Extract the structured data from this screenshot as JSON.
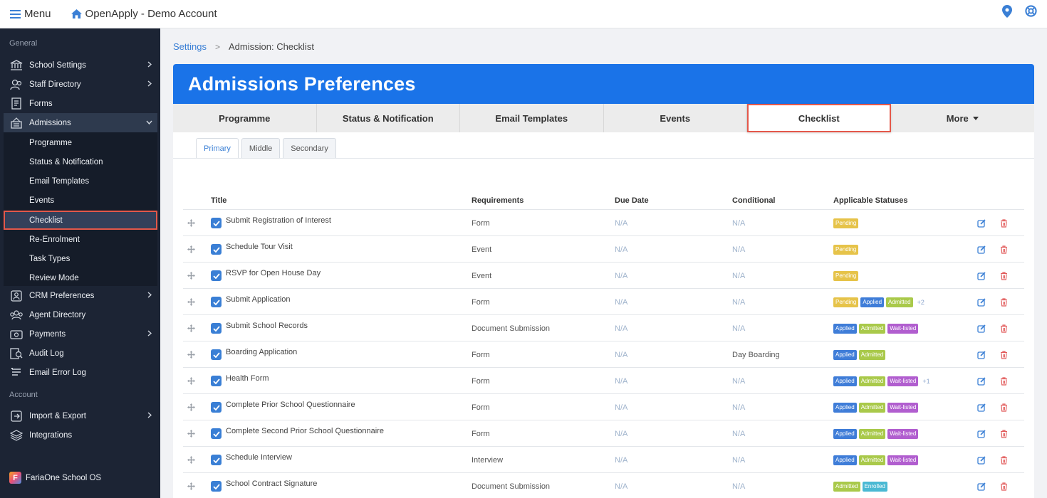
{
  "topbar": {
    "menu_label": "Menu",
    "brand": "OpenApply - Demo Account"
  },
  "sidebar": {
    "general_label": "General",
    "account_label": "Account",
    "items": [
      {
        "label": "School Settings",
        "icon": "bank-icon",
        "chevron": true
      },
      {
        "label": "Staff Directory",
        "icon": "users-icon",
        "chevron": true
      },
      {
        "label": "Forms",
        "icon": "forms-icon",
        "chevron": false
      },
      {
        "label": "Admissions",
        "icon": "admissions-icon",
        "chevron": true
      },
      {
        "label": "CRM Preferences",
        "icon": "crm-icon",
        "chevron": true
      },
      {
        "label": "Agent Directory",
        "icon": "agent-icon",
        "chevron": false
      },
      {
        "label": "Payments",
        "icon": "payments-icon",
        "chevron": true
      },
      {
        "label": "Audit Log",
        "icon": "audit-icon",
        "chevron": false
      },
      {
        "label": "Email Error Log",
        "icon": "email-error-icon",
        "chevron": false
      }
    ],
    "sub_items": [
      "Programme",
      "Status & Notification",
      "Email Templates",
      "Events",
      "Checklist",
      "Re-Enrolment",
      "Task Types",
      "Review Mode"
    ],
    "account_items": [
      {
        "label": "Import & Export",
        "icon": "import-icon",
        "chevron": true
      },
      {
        "label": "Integrations",
        "icon": "integrations-icon",
        "chevron": false
      }
    ],
    "footer": "FariaOne School OS"
  },
  "breadcrumb": {
    "parent": "Settings",
    "current": "Admission: Checklist"
  },
  "page": {
    "title": "Admissions Preferences"
  },
  "tabs": [
    "Programme",
    "Status & Notification",
    "Email Templates",
    "Events",
    "Checklist",
    "More"
  ],
  "subtabs": [
    "Primary",
    "Middle",
    "Secondary"
  ],
  "table": {
    "headers": {
      "title": "Title",
      "requirements": "Requirements",
      "due": "Due Date",
      "conditional": "Conditional",
      "statuses": "Applicable Statuses"
    },
    "rows": [
      {
        "title": "Submit Registration of Interest",
        "req": "Form",
        "due": "N/A",
        "cond": "N/A",
        "statuses": [
          "Pending"
        ],
        "more": ""
      },
      {
        "title": "Schedule Tour Visit",
        "req": "Event",
        "due": "N/A",
        "cond": "N/A",
        "statuses": [
          "Pending"
        ],
        "more": ""
      },
      {
        "title": "RSVP for Open House Day",
        "req": "Event",
        "due": "N/A",
        "cond": "N/A",
        "statuses": [
          "Pending"
        ],
        "more": ""
      },
      {
        "title": "Submit Application",
        "req": "Form",
        "due": "N/A",
        "cond": "N/A",
        "statuses": [
          "Pending",
          "Applied",
          "Admitted"
        ],
        "more": "+2"
      },
      {
        "title": "Submit School Records",
        "req": "Document Submission",
        "due": "N/A",
        "cond": "N/A",
        "statuses": [
          "Applied",
          "Admitted",
          "Wait-listed"
        ],
        "more": ""
      },
      {
        "title": "Boarding Application",
        "req": "Form",
        "due": "N/A",
        "cond": "Day Boarding",
        "statuses": [
          "Applied",
          "Admitted"
        ],
        "more": ""
      },
      {
        "title": "Health Form",
        "req": "Form",
        "due": "N/A",
        "cond": "N/A",
        "statuses": [
          "Applied",
          "Admitted",
          "Wait-listed"
        ],
        "more": "+1"
      },
      {
        "title": "Complete Prior School Questionnaire",
        "req": "Form",
        "due": "N/A",
        "cond": "N/A",
        "statuses": [
          "Applied",
          "Admitted",
          "Wait-listed"
        ],
        "more": ""
      },
      {
        "title": "Complete Second Prior School Questionnaire",
        "req": "Form",
        "due": "N/A",
        "cond": "N/A",
        "statuses": [
          "Applied",
          "Admitted",
          "Wait-listed"
        ],
        "more": ""
      },
      {
        "title": "Schedule Interview",
        "req": "Interview",
        "due": "N/A",
        "cond": "N/A",
        "statuses": [
          "Applied",
          "Admitted",
          "Wait-listed"
        ],
        "more": ""
      },
      {
        "title": "School Contract Signature",
        "req": "Document Submission",
        "due": "N/A",
        "cond": "N/A",
        "statuses": [
          "Admitted",
          "Enrolled"
        ],
        "more": ""
      }
    ]
  },
  "colors": {
    "accent": "#1a73e8",
    "highlight": "#e4584a",
    "sidebar": "#1c2434"
  }
}
